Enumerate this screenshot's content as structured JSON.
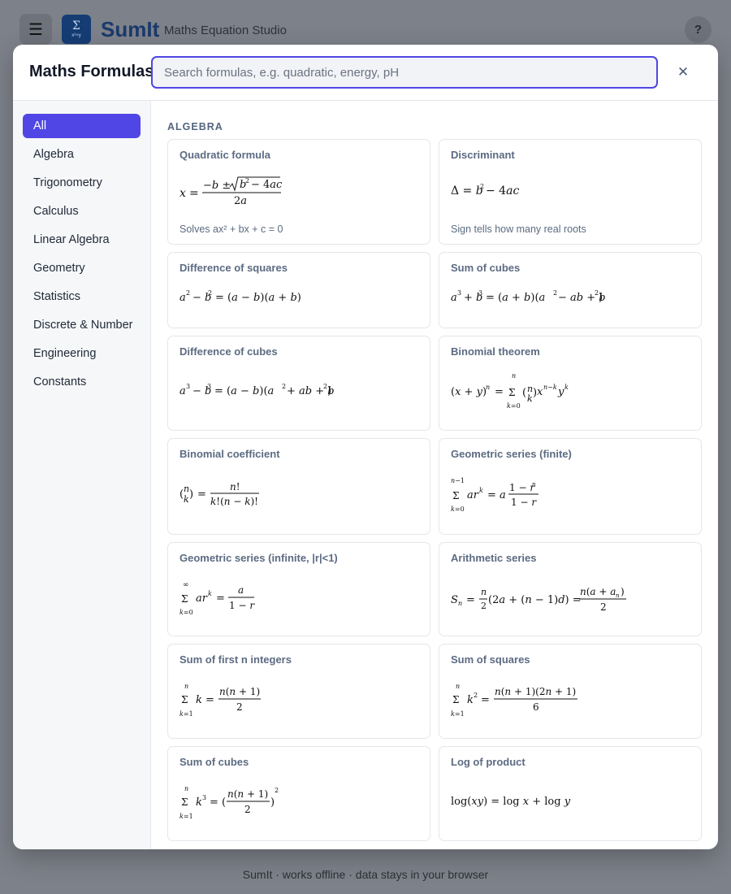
{
  "app": {
    "menu_icon": "hamburger-icon",
    "logo_glyph": "Σ",
    "logo_sub": "x²+y",
    "name": "SumIt",
    "subtitle": "Maths Equation Studio",
    "help_label": "?"
  },
  "modal": {
    "title": "Maths Formulas",
    "search_value": "",
    "search_placeholder": "Search formulas, e.g. quadratic, energy, pH",
    "close_label": "✕"
  },
  "categories": [
    "All",
    "Algebra",
    "Trigonometry",
    "Calculus",
    "Linear Algebra",
    "Geometry",
    "Statistics",
    "Discrete & Number",
    "Engineering",
    "Constants"
  ],
  "active_category": "All",
  "section": {
    "title": "ALGEBRA"
  },
  "formulas": [
    {
      "title": "Quadratic formula",
      "description": "Solves ax² + bx + c = 0"
    },
    {
      "title": "Discriminant",
      "description": "Sign tells how many real roots"
    },
    {
      "title": "Difference of squares",
      "description": ""
    },
    {
      "title": "Sum of cubes",
      "description": ""
    },
    {
      "title": "Difference of cubes",
      "description": ""
    },
    {
      "title": "Binomial theorem",
      "description": ""
    },
    {
      "title": "Binomial coefficient",
      "description": ""
    },
    {
      "title": "Geometric series (finite)",
      "description": ""
    },
    {
      "title": "Geometric series (infinite, |r|<1)",
      "description": ""
    },
    {
      "title": "Arithmetic series",
      "description": ""
    },
    {
      "title": "Sum of first n integers",
      "description": ""
    },
    {
      "title": "Sum of squares",
      "description": ""
    },
    {
      "title": "Sum of cubes",
      "description": ""
    },
    {
      "title": "Log of product",
      "description": ""
    }
  ],
  "footer": {
    "text": "SumIt · works offline · data stays in your browser"
  },
  "colors": {
    "accent": "#4f46e5",
    "brand": "#1b3a6c",
    "overlay": "#7d8189"
  }
}
